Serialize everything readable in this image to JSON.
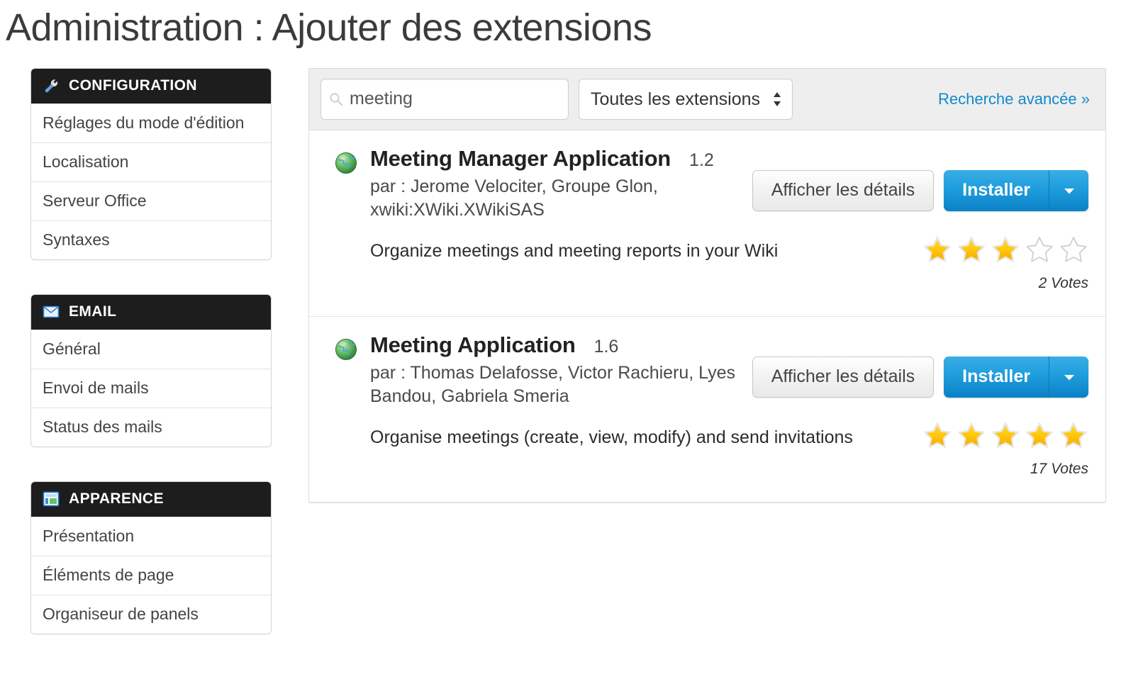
{
  "page": {
    "title": "Administration : Ajouter des extensions"
  },
  "sidebar": {
    "groups": [
      {
        "title": "CONFIGURATION",
        "icon": "wrench-icon",
        "items": [
          "Réglages du mode d'édition",
          "Localisation",
          "Serveur Office",
          "Syntaxes"
        ]
      },
      {
        "title": "EMAIL",
        "icon": "envelope-icon",
        "items": [
          "Général",
          "Envoi de mails",
          "Status des mails"
        ]
      },
      {
        "title": "APPARENCE",
        "icon": "layout-icon",
        "items": [
          "Présentation",
          "Éléments de page",
          "Organiseur de panels"
        ]
      }
    ]
  },
  "toolbar": {
    "search": {
      "value": "meeting",
      "placeholder": "Rechercher",
      "icon": "search-icon"
    },
    "scope": {
      "selected": "Toutes les extensions",
      "options": [
        "Toutes les extensions"
      ],
      "icon": "updown-caret-icon"
    },
    "advanced_search_label": "Recherche avancée »"
  },
  "extensions": [
    {
      "icon": "globe-icon",
      "name": "Meeting Manager Application",
      "version": "1.2",
      "authors": "par : Jerome Velociter, Groupe Glon, xwiki:XWiki.XWikiSAS",
      "description": "Organize meetings and meeting reports in your Wiki",
      "details_label": "Afficher les détails",
      "install_label": "Installer",
      "rating": 3,
      "max_rating": 5,
      "votes": "2 Votes"
    },
    {
      "icon": "globe-icon",
      "name": "Meeting Application",
      "version": "1.6",
      "authors": "par : Thomas Delafosse, Victor Rachieru, Lyes Bandou, Gabriela Smeria",
      "description": "Organise meetings (create, view, modify) and send invitations",
      "details_label": "Afficher les détails",
      "install_label": "Installer",
      "rating": 5,
      "max_rating": 5,
      "votes": "17 Votes"
    }
  ],
  "colors": {
    "accent_blue": "#1189cc",
    "install_blue": "#1f9ddd",
    "header_black": "#1d1d1d",
    "star_gold": "#ffc80a",
    "toolbar_gray": "#eeeeee"
  }
}
